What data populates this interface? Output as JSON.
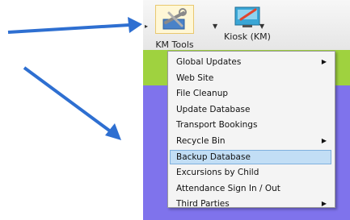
{
  "toolbar": {
    "km_tools": {
      "label": "KM Tools",
      "icon": "tools-icon"
    },
    "kiosk": {
      "label": "Kiosk (KM)",
      "icon": "kiosk-icon"
    }
  },
  "menu": {
    "items": [
      {
        "label": "Global Updates",
        "submenu": true,
        "selected": false
      },
      {
        "label": "Web Site",
        "submenu": false,
        "selected": false
      },
      {
        "label": "File Cleanup",
        "submenu": false,
        "selected": false
      },
      {
        "label": "Update Database",
        "submenu": false,
        "selected": false
      },
      {
        "label": "Transport Bookings",
        "submenu": false,
        "selected": false
      },
      {
        "label": "Recycle Bin",
        "submenu": true,
        "selected": false
      },
      {
        "label": "Backup Database",
        "submenu": false,
        "selected": true
      },
      {
        "label": "Excursions by Child",
        "submenu": false,
        "selected": false
      },
      {
        "label": "Attendance Sign In / Out",
        "submenu": false,
        "selected": false
      },
      {
        "label": "Third Parties",
        "submenu": true,
        "selected": false
      }
    ]
  },
  "colors": {
    "app_background": "#7f73ec",
    "green_band": "#9fd23f",
    "selection": "#c2def5",
    "annotation_arrow": "#2e6fd1"
  }
}
